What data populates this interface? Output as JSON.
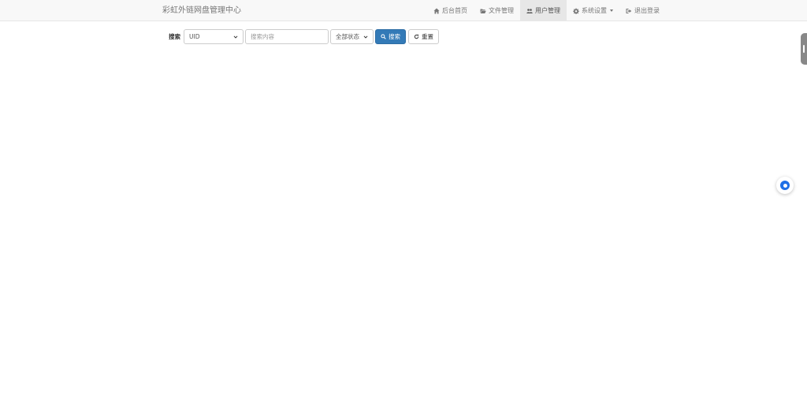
{
  "brand": {
    "title": "彩虹外链网盘管理中心"
  },
  "nav": {
    "items": [
      {
        "label": "后台首页",
        "icon": "home-icon"
      },
      {
        "label": "文件管理",
        "icon": "folder-open-icon"
      },
      {
        "label": "用户管理",
        "icon": "users-icon",
        "active": true
      },
      {
        "label": "系统设置",
        "icon": "gear-icon",
        "dropdown": true
      },
      {
        "label": "退出登录",
        "icon": "sign-out-icon"
      }
    ]
  },
  "search": {
    "label": "搜索",
    "field_select_value": "UID",
    "keyword_placeholder": "搜索内容",
    "status_select_value": "全部状态",
    "search_button": "搜索",
    "reset_button": "重置"
  },
  "colors": {
    "primary": "#337ab7",
    "navbar_bg": "#f8f8f8",
    "active_nav_bg": "#e7e7e7",
    "float_button": "#1e6fe6"
  }
}
